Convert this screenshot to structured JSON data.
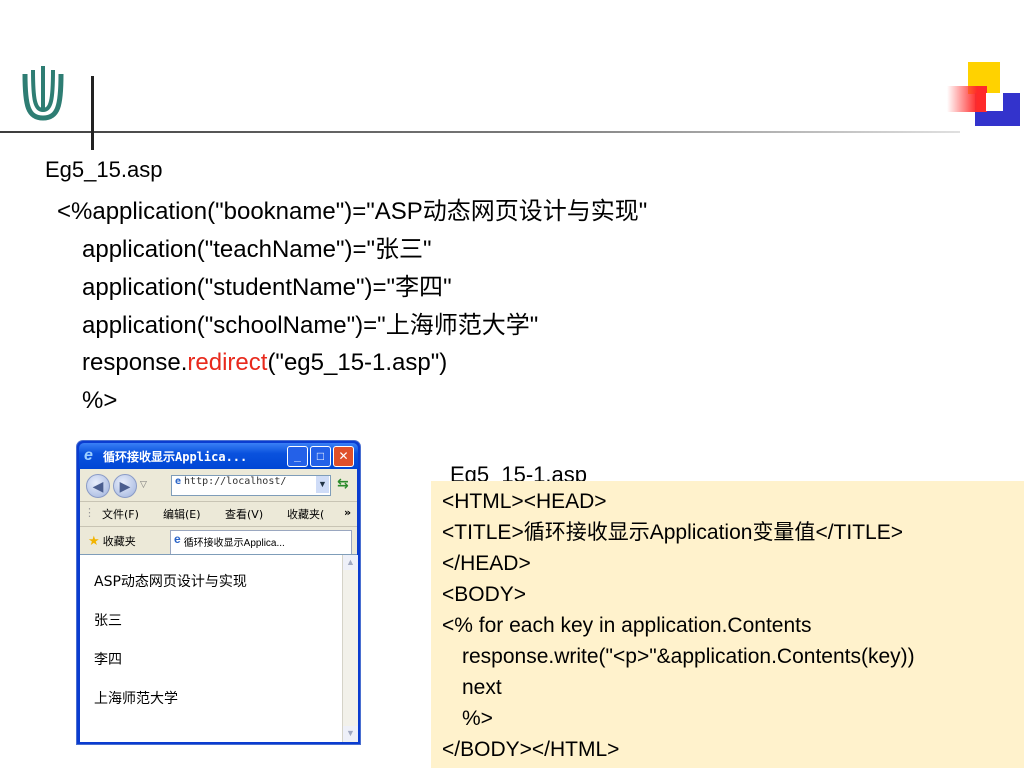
{
  "slide": {
    "file1": "Eg5_15.asp",
    "file2": "Eg5_15-1.asp",
    "asp_lines": [
      {
        "a": "<%application(\"bookname\")=\"ASP",
        "b": "动态网页设计与实现",
        "c": "\""
      },
      {
        "a": "application(\"teachName\")=\"",
        "b": "张三",
        "c": "\""
      },
      {
        "a": "application(\"studentName\")=\"",
        "b": "李四",
        "c": "\""
      },
      {
        "a": "application(\"schoolName\")=\"",
        "b": "上海师范大学",
        "c": "\""
      }
    ],
    "redirect_line": {
      "pre": "response.",
      "keyword": "redirect",
      "post": "(\"eg5_15-1.asp\")"
    },
    "asp_close": "%>",
    "code_box": [
      "<HTML><HEAD>",
      {
        "a": "<TITLE>",
        "b": "循环接收显示",
        "c": "Application",
        "d": "变量值",
        "e": "</TITLE>"
      },
      "</HEAD>",
      "<BODY>",
      "<%  for each key in application.Contents",
      "response.write(\"<p>\"&application.Contents(key))",
      "next",
      "%>",
      "</BODY></HTML>"
    ],
    "colors": {
      "keyword": "#e8291c",
      "code_bg": "#fff2cc"
    }
  },
  "browser": {
    "title": "循环接收显示Applica...",
    "address": "http://localhost/",
    "menus": [
      "文件(F)",
      "编辑(E)",
      "查看(V)",
      "收藏夹("
    ],
    "more": "»",
    "favorites": "收藏夹",
    "tab": "循环接收显示Applica...",
    "lines": [
      "ASP动态网页设计与实现",
      "张三",
      "李四",
      "上海师范大学"
    ],
    "buttons": {
      "minimize": "_",
      "maximize": "□",
      "close": "✕"
    }
  }
}
